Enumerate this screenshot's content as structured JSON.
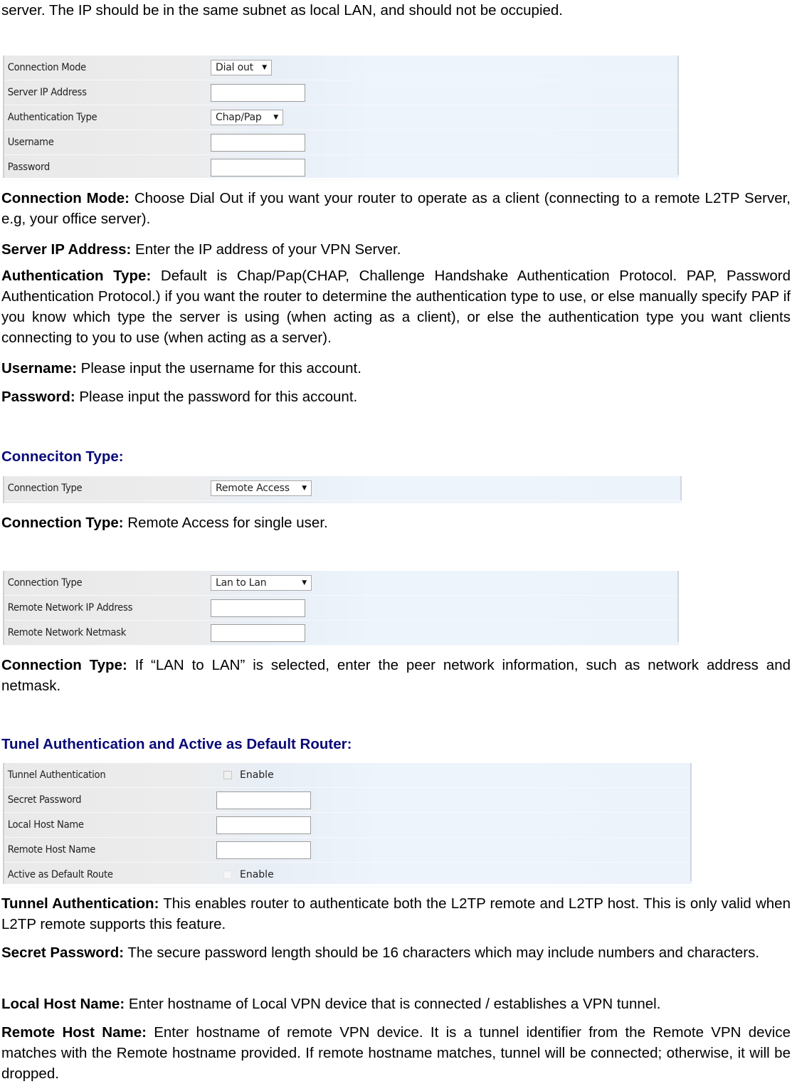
{
  "intro_text": "server. The IP should be in the same subnet as local LAN, and should not be occupied.",
  "form_dialout": {
    "rows": [
      {
        "label": "Connection Mode",
        "type": "select",
        "value": "Dial out"
      },
      {
        "label": "Server IP Address",
        "type": "input",
        "value": ""
      },
      {
        "label": "Authentication Type",
        "type": "select",
        "value": "Chap/Pap"
      },
      {
        "label": "Username",
        "type": "input",
        "value": ""
      },
      {
        "label": "Password",
        "type": "input",
        "value": ""
      }
    ]
  },
  "desc_dialout": [
    {
      "term": "Connection Mode:",
      "text": " Choose Dial Out if you want your router to operate as a client (connecting to a remote L2TP Server, e.g, your office server)."
    },
    {
      "term": "Server IP Address:",
      "text": " Enter the IP address of your VPN Server."
    },
    {
      "term": "Authentication Type:",
      "text": " Default is Chap/Pap(CHAP, Challenge Handshake Authentication Protocol. PAP, Password Authentication Protocol.) if you want the router to determine the authentication type to use, or else manually specify PAP if you know which type the server is using (when acting as a client), or else the authentication type you want clients connecting to you to use (when acting as a server)."
    },
    {
      "term": "Username:",
      "text": " Please input the username for this account."
    },
    {
      "term": "Password:",
      "text": " Please input the password for this account."
    }
  ],
  "heading_connection_type": "Conneciton Type:",
  "form_remote_access": {
    "rows": [
      {
        "label": "Connection Type",
        "type": "select",
        "value": "Remote Access"
      }
    ]
  },
  "desc_remote_access": {
    "term": "Connection Type:",
    "text": " Remote Access for single user."
  },
  "form_lan_to_lan": {
    "rows": [
      {
        "label": "Connection Type",
        "type": "select",
        "value": "Lan to Lan"
      },
      {
        "label": "Remote Network IP Address",
        "type": "input",
        "value": ""
      },
      {
        "label": "Remote Network Netmask",
        "type": "input",
        "value": ""
      }
    ]
  },
  "desc_lan_to_lan": {
    "term": "Connection Type:",
    "text": " If “LAN to LAN” is selected, enter the peer network information, such as network address and netmask."
  },
  "heading_tunnel": "Tunel Authentication and Active as Default Router:",
  "form_tunnel": {
    "rows": [
      {
        "label": "Tunnel Authentication",
        "type": "checkbox",
        "value": "Enable",
        "checked": false
      },
      {
        "label": "Secret Password",
        "type": "input",
        "value": ""
      },
      {
        "label": "Local Host Name",
        "type": "input",
        "value": ""
      },
      {
        "label": "Remote Host Name",
        "type": "input",
        "value": ""
      },
      {
        "label": "Active as Default Route",
        "type": "checkbox",
        "value": "Enable",
        "checked": false
      }
    ]
  },
  "desc_tunnel": [
    {
      "term": "Tunnel Authentication:",
      "text": " This enables router to authenticate both the L2TP remote and L2TP host. This is only valid when L2TP remote supports this feature."
    },
    {
      "term": "Secret Password:",
      "text": " The secure password length should be 16 characters which may include numbers and characters."
    },
    {
      "term": "Local Host Name:",
      "text": " Enter hostname of Local VPN device that is connected / establishes a VPN tunnel."
    },
    {
      "term": "Remote Host Name:",
      "text": " Enter hostname of remote VPN device. It is a tunnel identifier from the Remote VPN device matches with the Remote hostname provided. If remote hostname matches, tunnel will be connected; otherwise, it will be dropped."
    }
  ],
  "colors": {
    "heading": "#0a0a78",
    "panel_label_bg": "#e9e9e9",
    "panel_value_bg": "#eef4fc"
  }
}
